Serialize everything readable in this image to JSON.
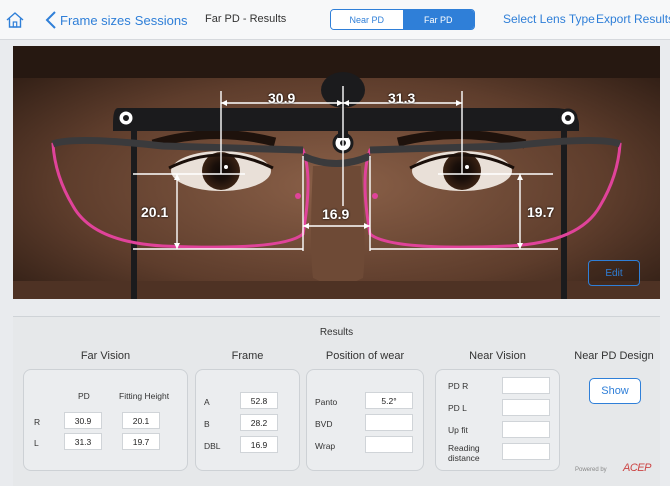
{
  "nav": {
    "back_label": "Frame sizes",
    "sessions_label": "Sessions",
    "title": "Far PD - Results",
    "segments": [
      "Near PD",
      "Far PD"
    ],
    "active_segment": "Far PD",
    "select_lens_label": "Select Lens Type",
    "export_label": "Export Results"
  },
  "photo": {
    "measurements": {
      "pd_right": "30.9",
      "pd_left": "31.3",
      "height_right": "20.1",
      "height_left": "19.7",
      "bridge": "16.9"
    },
    "edit_label": "Edit",
    "accent_color": "#e0439a"
  },
  "results": {
    "title": "Results",
    "far_vision": {
      "title": "Far Vision",
      "col_pd": "PD",
      "col_height": "Fitting Height",
      "rows": [
        {
          "eye": "R",
          "pd": "30.9",
          "height": "20.1"
        },
        {
          "eye": "L",
          "pd": "31.3",
          "height": "19.7"
        }
      ]
    },
    "frame": {
      "title": "Frame",
      "rows": [
        {
          "label": "A",
          "value": "52.8"
        },
        {
          "label": "B",
          "value": "28.2"
        },
        {
          "label": "DBL",
          "value": "16.9"
        }
      ]
    },
    "position": {
      "title": "Position of wear",
      "rows": [
        {
          "label": "Panto",
          "value": "5.2°"
        },
        {
          "label": "BVD",
          "value": ""
        },
        {
          "label": "Wrap",
          "value": ""
        }
      ]
    },
    "near_vision": {
      "title": "Near Vision",
      "rows": [
        {
          "label": "PD R",
          "value": ""
        },
        {
          "label": "PD L",
          "value": ""
        },
        {
          "label": "Up fit",
          "value": ""
        },
        {
          "label": "Reading distance",
          "value": ""
        }
      ]
    },
    "near_pd_design": {
      "title": "Near PD Design",
      "show_label": "Show"
    },
    "powered_by": "Powered by",
    "brand": "ACEP"
  }
}
